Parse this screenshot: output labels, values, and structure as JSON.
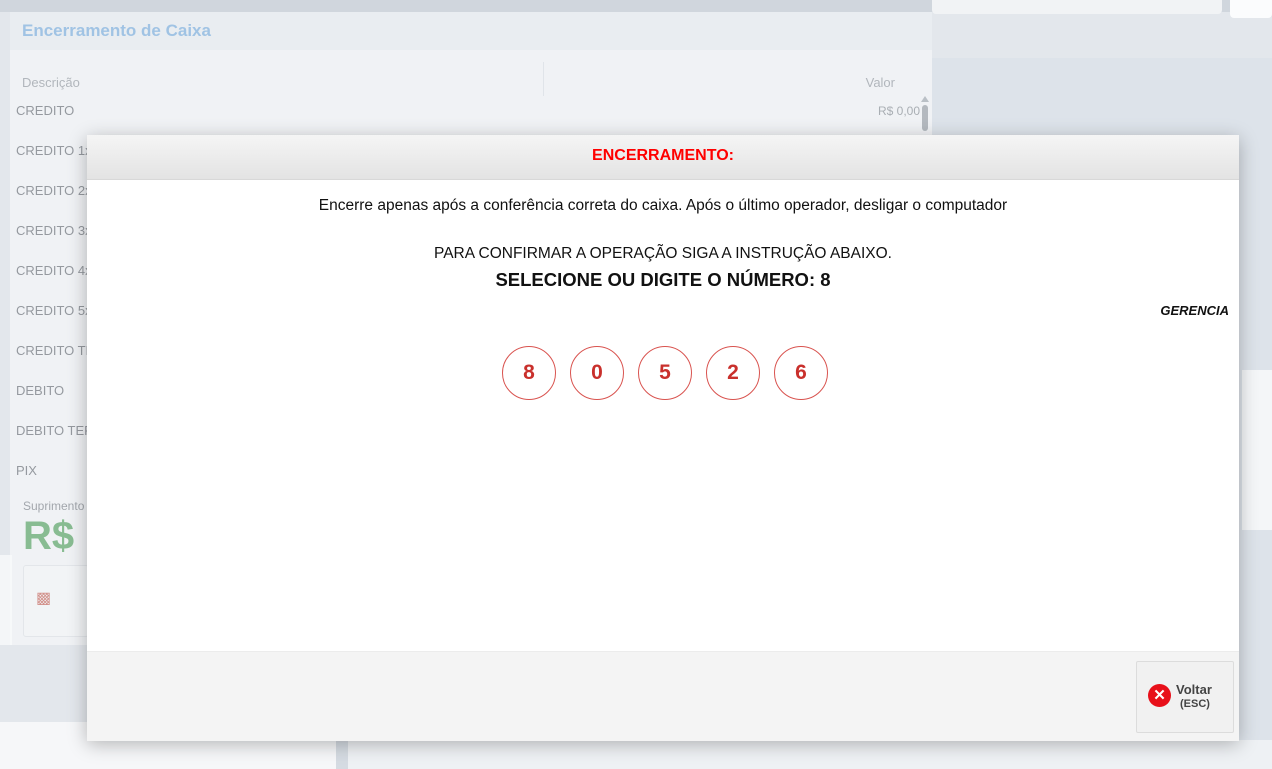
{
  "background_window": {
    "title": "Encerramento de Caixa",
    "columns": [
      "Descrição",
      "Valor"
    ],
    "rows": [
      {
        "label": "CREDITO",
        "value": "R$ 0,00"
      },
      {
        "label": "CREDITO 1x",
        "value": ""
      },
      {
        "label": "CREDITO 2x",
        "value": ""
      },
      {
        "label": "CREDITO 3x",
        "value": ""
      },
      {
        "label": "CREDITO 4x",
        "value": ""
      },
      {
        "label": "CREDITO 5x",
        "value": ""
      },
      {
        "label": "CREDITO TEF",
        "value": ""
      },
      {
        "label": "DEBITO",
        "value": ""
      },
      {
        "label": "DEBITO TEF",
        "value": ""
      },
      {
        "label": "PIX",
        "value": ""
      }
    ],
    "suprimento_label": "Suprimento",
    "suprimento_value": "R$"
  },
  "modal": {
    "title": "ENCERRAMENTO:",
    "message": "Encerre apenas após a conferência correta do caixa. Após o último operador, desligar o computador",
    "instruction": "PARA CONFIRMAR A OPERAÇÃO SIGA A INSTRUÇÃO ABAIXO.",
    "prompt": "SELECIONE OU DIGITE O NÚMERO: 8",
    "role": "GERENCIA",
    "digits": [
      "8",
      "0",
      "5",
      "2",
      "6"
    ],
    "back_button": {
      "label": "Voltar",
      "shortcut": "(ESC)",
      "icon": "close-circle-icon",
      "color": "#e8101a"
    }
  },
  "colors": {
    "title_red": "#ff0000",
    "digit_border": "#d9534f",
    "accent_blue": "#6aa7de"
  }
}
